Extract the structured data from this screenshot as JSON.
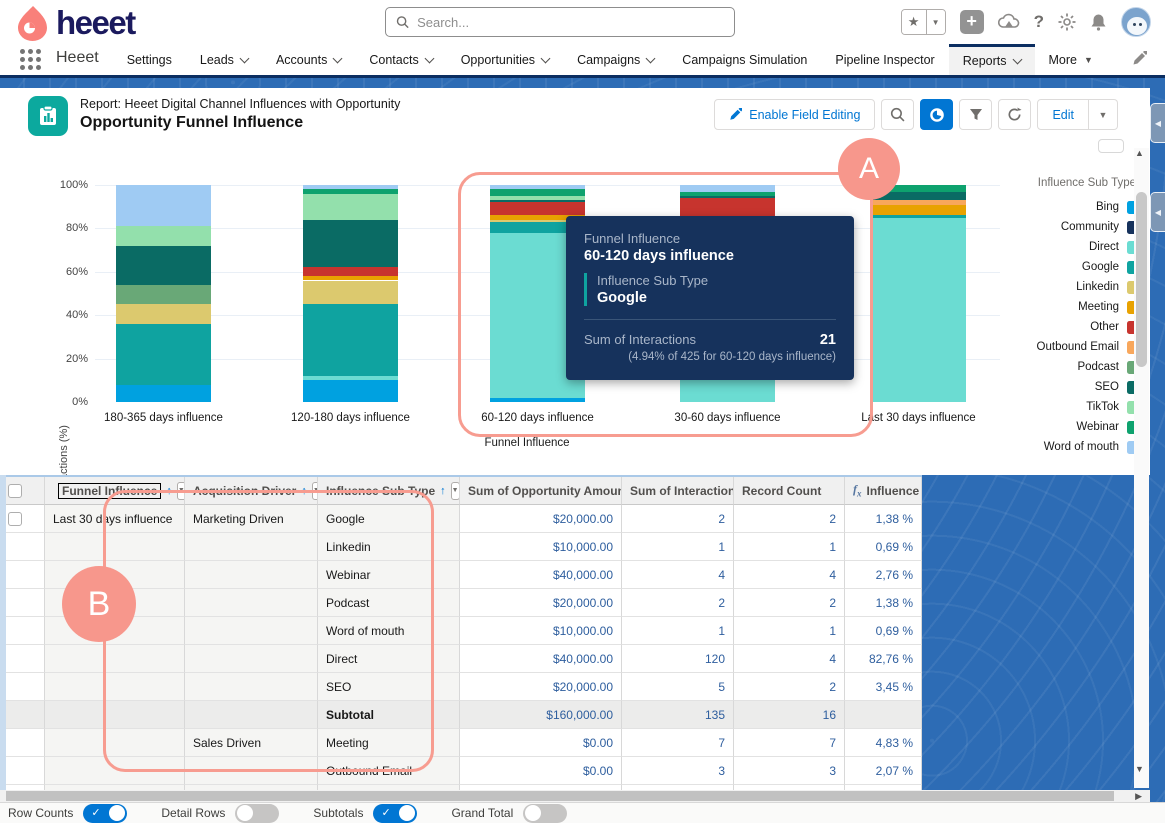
{
  "header": {
    "logo_text": "heeet",
    "search_placeholder": "Search..."
  },
  "nav": {
    "app_name": "Heeet",
    "items": [
      {
        "label": "Settings",
        "caret": false,
        "active": false
      },
      {
        "label": "Leads",
        "caret": true,
        "active": false
      },
      {
        "label": "Accounts",
        "caret": true,
        "active": false
      },
      {
        "label": "Contacts",
        "caret": true,
        "active": false
      },
      {
        "label": "Opportunities",
        "caret": true,
        "active": false
      },
      {
        "label": "Campaigns",
        "caret": true,
        "active": false
      },
      {
        "label": "Campaigns Simulation",
        "caret": false,
        "active": false
      },
      {
        "label": "Pipeline Inspector",
        "caret": false,
        "active": false
      },
      {
        "label": "Reports",
        "caret": true,
        "active": true
      },
      {
        "label": "More",
        "caret": "filled",
        "active": false
      }
    ]
  },
  "report_header": {
    "report_label": "Report: Heeet Digital Channel Influences with Opportunity",
    "title": "Opportunity Funnel Influence",
    "enable_field_editing_label": "Enable Field Editing",
    "edit_label": "Edit"
  },
  "chart_data": {
    "type": "bar",
    "stacked": true,
    "normalized_percent": true,
    "title": "",
    "xlabel": "Funnel Influence",
    "ylabel": "Sum of Interactions (%)",
    "ylim": [
      0,
      100
    ],
    "yticks": [
      {
        "label": "100%",
        "value": 100
      },
      {
        "label": "80%",
        "value": 80
      },
      {
        "label": "60%",
        "value": 60
      },
      {
        "label": "40%",
        "value": 40
      },
      {
        "label": "20%",
        "value": 20
      },
      {
        "label": "0%",
        "value": 0
      }
    ],
    "grid": true,
    "legend_position": "right",
    "legend_title": "Influence Sub Type",
    "categories": [
      "180-365 days influence",
      "120-180 days influence",
      "60-120 days influence",
      "30-60 days influence",
      "Last 30 days influence"
    ],
    "series": [
      {
        "name": "Bing",
        "color": "#00a1e0",
        "values": [
          8,
          10,
          2,
          0,
          0
        ]
      },
      {
        "name": "Community",
        "color": "#16325c",
        "values": [
          0,
          0,
          0,
          0,
          0
        ]
      },
      {
        "name": "Direct",
        "color": "#6bdcd2",
        "values": [
          0,
          2,
          76,
          84,
          85
        ]
      },
      {
        "name": "Google",
        "color": "#0fa3a0",
        "values": [
          28,
          33,
          5,
          0,
          1
        ]
      },
      {
        "name": "Linkedin",
        "color": "#dcc96e",
        "values": [
          9,
          11,
          1,
          0,
          0
        ]
      },
      {
        "name": "Meeting",
        "color": "#e8a201",
        "values": [
          0,
          2,
          2,
          0,
          5
        ]
      },
      {
        "name": "Other",
        "color": "#c7342e",
        "values": [
          0,
          4,
          6,
          10,
          0
        ]
      },
      {
        "name": "Outbound Email",
        "color": "#f8a75c",
        "values": [
          0,
          0,
          0,
          0,
          2
        ]
      },
      {
        "name": "Podcast",
        "color": "#69a877",
        "values": [
          9,
          0,
          0,
          0,
          0
        ]
      },
      {
        "name": "SEO",
        "color": "#0a6b64",
        "values": [
          18,
          22,
          1,
          1,
          4
        ]
      },
      {
        "name": "TikTok",
        "color": "#93e0ac",
        "values": [
          9,
          12,
          2,
          0,
          0
        ]
      },
      {
        "name": "Webinar",
        "color": "#0ea26e",
        "values": [
          0,
          2,
          3,
          2,
          3
        ]
      },
      {
        "name": "Word of mouth",
        "color": "#9fcbf3",
        "values": [
          19,
          2,
          2,
          3,
          0
        ]
      }
    ]
  },
  "tooltip": {
    "group_label": "Funnel Influence",
    "group_value": "60-120 days influence",
    "sub_label": "Influence Sub Type",
    "sub_value": "Google",
    "measure_label": "Sum of Interactions",
    "measure_value": "21",
    "note": "(4.94% of 425 for 60-120 days influence)"
  },
  "annotations": {
    "a": "A",
    "b": "B"
  },
  "table": {
    "columns": [
      "Funnel Influence",
      "Acquisition Driver",
      "Influence Sub Type",
      "Sum of Opportunity Amount",
      "Sum of Interactions",
      "Record Count",
      "Influence %"
    ],
    "rows": [
      {
        "checkbox": true,
        "funnel": "Last 30 days influence",
        "driver": "Marketing Driven",
        "sub": "Google",
        "amount": "$20,000.00",
        "interactions": "2",
        "records": "2",
        "influence": "1,38 %",
        "subtotal": false
      },
      {
        "checkbox": false,
        "funnel": "",
        "driver": "",
        "sub": "Linkedin",
        "amount": "$10,000.00",
        "interactions": "1",
        "records": "1",
        "influence": "0,69 %",
        "subtotal": false
      },
      {
        "checkbox": false,
        "funnel": "",
        "driver": "",
        "sub": "Webinar",
        "amount": "$40,000.00",
        "interactions": "4",
        "records": "4",
        "influence": "2,76 %",
        "subtotal": false
      },
      {
        "checkbox": false,
        "funnel": "",
        "driver": "",
        "sub": "Podcast",
        "amount": "$20,000.00",
        "interactions": "2",
        "records": "2",
        "influence": "1,38 %",
        "subtotal": false
      },
      {
        "checkbox": false,
        "funnel": "",
        "driver": "",
        "sub": "Word of mouth",
        "amount": "$10,000.00",
        "interactions": "1",
        "records": "1",
        "influence": "0,69 %",
        "subtotal": false
      },
      {
        "checkbox": false,
        "funnel": "",
        "driver": "",
        "sub": "Direct",
        "amount": "$40,000.00",
        "interactions": "120",
        "records": "4",
        "influence": "82,76 %",
        "subtotal": false
      },
      {
        "checkbox": false,
        "funnel": "",
        "driver": "",
        "sub": "SEO",
        "amount": "$20,000.00",
        "interactions": "5",
        "records": "2",
        "influence": "3,45 %",
        "subtotal": false
      },
      {
        "checkbox": false,
        "funnel": "",
        "driver": "",
        "sub": "Subtotal",
        "amount": "$160,000.00",
        "interactions": "135",
        "records": "16",
        "influence": "",
        "subtotal": true
      },
      {
        "checkbox": false,
        "funnel": "",
        "driver": "Sales Driven",
        "sub": "Meeting",
        "amount": "$0.00",
        "interactions": "7",
        "records": "7",
        "influence": "4,83 %",
        "subtotal": false
      },
      {
        "checkbox": false,
        "funnel": "",
        "driver": "",
        "sub": "Outbound Email",
        "amount": "$0.00",
        "interactions": "3",
        "records": "3",
        "influence": "2,07 %",
        "subtotal": false
      }
    ]
  },
  "footer": {
    "toggles": [
      {
        "label": "Row Counts",
        "on": true
      },
      {
        "label": "Detail Rows",
        "on": false
      },
      {
        "label": "Subtotals",
        "on": true
      },
      {
        "label": "Grand Total",
        "on": false
      }
    ]
  },
  "colors": {
    "accent_blue": "#0176d3",
    "navy": "#16325c",
    "annotation_salmon": "#f7978c",
    "report_icon_teal": "#0ca99e",
    "nav_underline_navy": "#0b2e61"
  }
}
